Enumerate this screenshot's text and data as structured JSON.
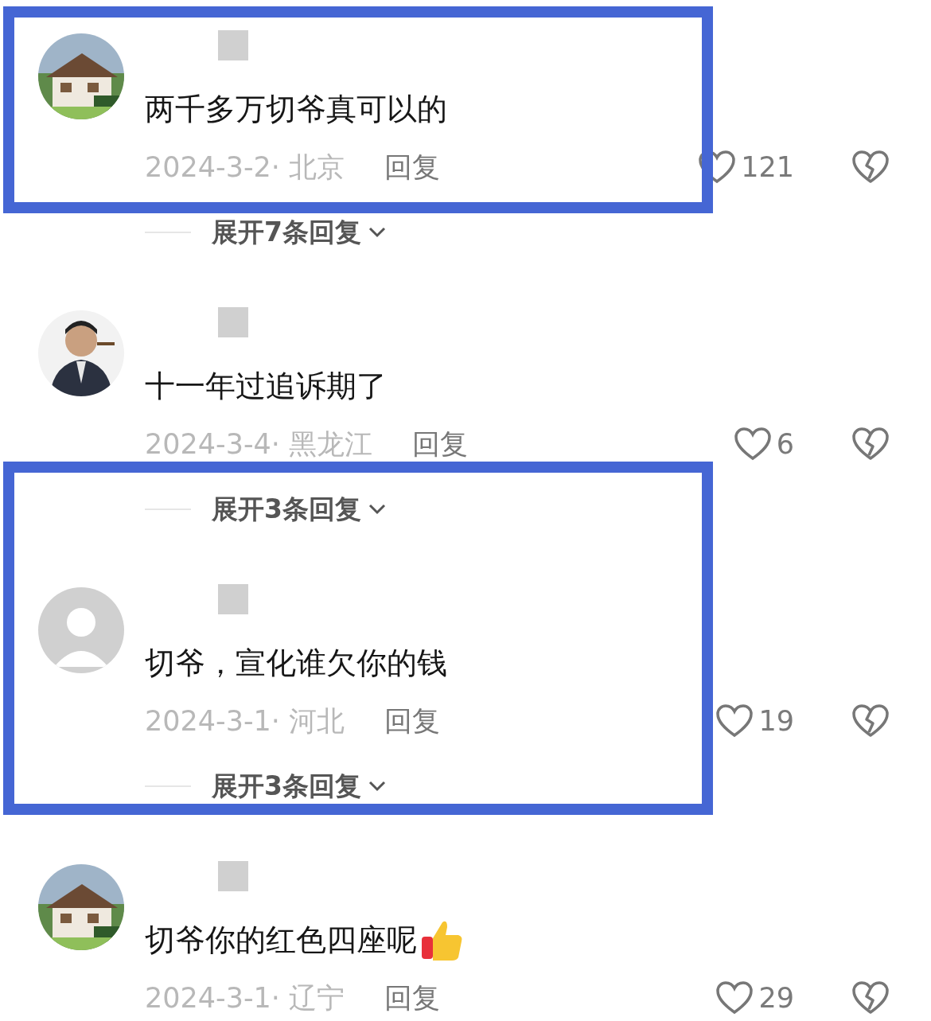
{
  "sections": [
    {
      "highlighted": true,
      "items": [
        {
          "kind": "comment",
          "text": "两千多万切爷真可以的",
          "emoji": false,
          "meta": "2024-3-2· 北京",
          "reply": "回复",
          "likes": "121"
        }
      ]
    },
    {
      "highlighted": false,
      "items": [
        {
          "kind": "expand",
          "label": "展开7条回复"
        },
        {
          "kind": "comment",
          "text": "十一年过追诉期了",
          "emoji": false,
          "meta": "2024-3-4· 黑龙江",
          "reply": "回复",
          "likes": "6"
        }
      ]
    },
    {
      "highlighted": true,
      "items": [
        {
          "kind": "expand",
          "label": "展开3条回复"
        },
        {
          "kind": "comment",
          "avatar": {
            "kind": "default"
          },
          "text": "切爷，宣化谁欠你的钱",
          "emoji": false,
          "meta": "2024-3-1· 河北",
          "reply": "回复",
          "likes": "19"
        },
        {
          "kind": "expand",
          "label": "展开3条回复"
        }
      ]
    },
    {
      "highlighted": false,
      "items": [
        {
          "kind": "comment",
          "text": "切爷你的红色四座呢",
          "emoji": true,
          "meta": "2024-3-1· 辽宁",
          "reply": "回复",
          "likes": "29"
        }
      ]
    }
  ]
}
